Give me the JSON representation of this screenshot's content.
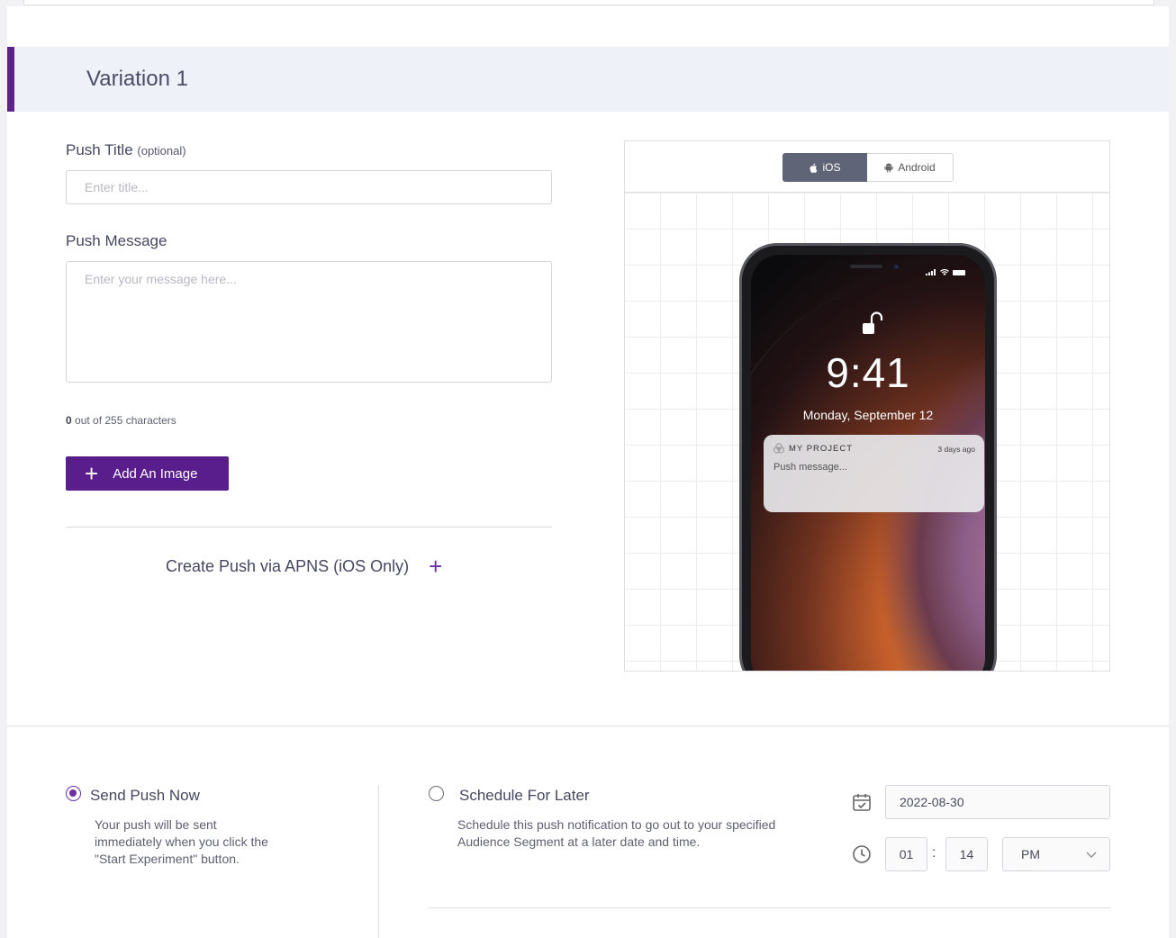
{
  "variation": {
    "title": "Variation 1"
  },
  "form": {
    "push_title_label": "Push Title",
    "push_title_optional": "(optional)",
    "push_title_placeholder": "Enter title...",
    "push_message_label": "Push Message",
    "push_message_placeholder": "Enter your message here...",
    "char_count": "0",
    "char_count_suffix": " out of 255 characters",
    "add_image_label": "Add An Image",
    "apns_label": "Create Push via APNS (iOS Only)"
  },
  "preview": {
    "tabs": [
      {
        "label": "iOS",
        "selected": true
      },
      {
        "label": "Android",
        "selected": false
      }
    ],
    "time": "9:41",
    "date": "Monday, September 12",
    "notification": {
      "app_name": "MY PROJECT",
      "time": "3 days ago",
      "message": "Push message..."
    }
  },
  "delivery": {
    "send_now": {
      "label": "Send Push Now",
      "selected": true,
      "description": "Your push will be sent immediately when you click the \"Start Experiment\" button."
    },
    "schedule": {
      "label": "Schedule For Later",
      "selected": false,
      "description": "Schedule this push notification to go out to your specified Audience Segment at a later date and time.",
      "date": "2022-08-30",
      "hour": "01",
      "minute": "14",
      "ampm": "PM"
    }
  },
  "colors": {
    "accent": "#5a1e8c",
    "header_bg": "#eff1f9",
    "ios_tab": "#5f6577"
  },
  "icons": [
    "apple-icon",
    "android-icon",
    "plus-icon",
    "calendar-icon",
    "clock-icon",
    "chevron-down-icon",
    "lock-icon"
  ]
}
